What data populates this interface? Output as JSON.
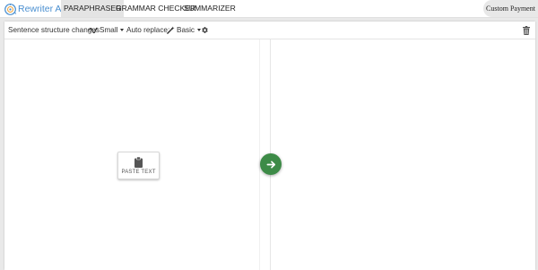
{
  "brand": {
    "name": "Rewriter AI"
  },
  "nav": {
    "items": [
      "PARAPHRASER",
      "GRAMMAR CHECKER",
      "SUMMARIZER"
    ],
    "active": "PARAPHRASER",
    "custom_payment": "Custom Payment"
  },
  "toolbar": {
    "sentence_label": "Sentence structure changes",
    "sentence_value": "Small",
    "auto_replace_label": "Auto replace:",
    "auto_replace_value": "Basic"
  },
  "editor": {
    "paste_label": "PASTE TEXT"
  },
  "colors": {
    "accent_green": "#3d8b47",
    "brand_blue": "#4a8fd0"
  },
  "icons": [
    "logo-icon",
    "wave-icon",
    "magic-wand-icon",
    "gear-icon",
    "trash-icon",
    "clipboard-icon",
    "arrow-right-icon"
  ]
}
